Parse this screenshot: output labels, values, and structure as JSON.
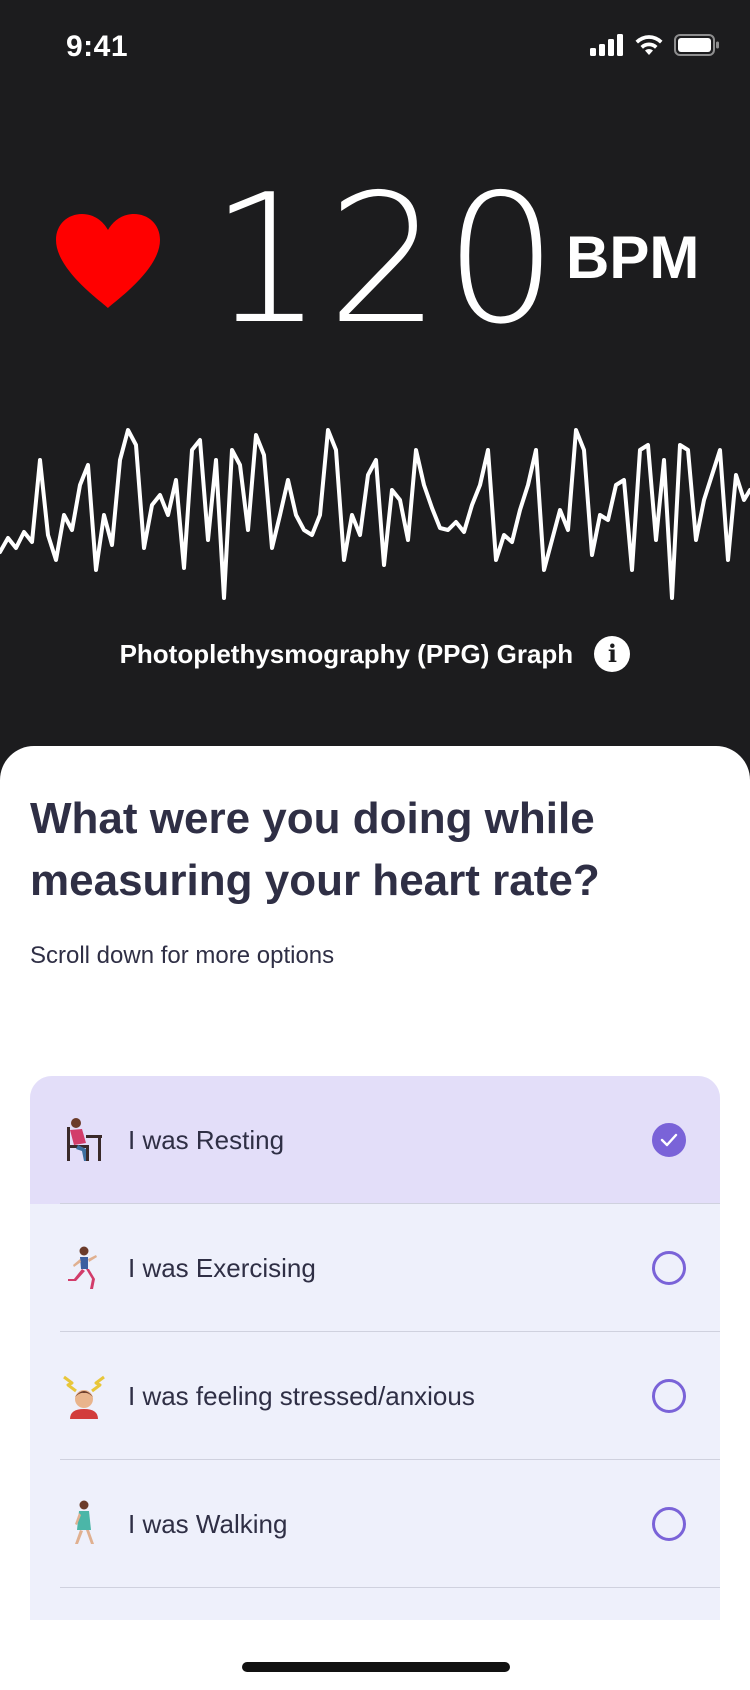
{
  "status_bar": {
    "time": "9:41",
    "icons": [
      "signal-icon",
      "wifi-icon",
      "battery-icon"
    ]
  },
  "reading": {
    "bpm": "120",
    "unit": "BPM",
    "heart_color": "#ff0000"
  },
  "ppg": {
    "label": "Photoplethysmography (PPG) Graph",
    "info_glyph": "i"
  },
  "sheet": {
    "question": "What were you doing while measuring your heart rate?",
    "hint": "Scroll down for more options"
  },
  "options": [
    {
      "label": "I was Resting",
      "icon": "resting-person-icon",
      "selected": true
    },
    {
      "label": "I was Exercising",
      "icon": "running-person-icon",
      "selected": false
    },
    {
      "label": "I was feeling stressed/anxious",
      "icon": "stressed-person-icon",
      "selected": false
    },
    {
      "label": "I was Walking",
      "icon": "walking-person-icon",
      "selected": false
    }
  ],
  "colors": {
    "accent": "#7a63d8",
    "selected_row": "#e3def9",
    "row": "#eef0fb",
    "dark_bg": "#1c1c1e",
    "text": "#2f2f45"
  }
}
